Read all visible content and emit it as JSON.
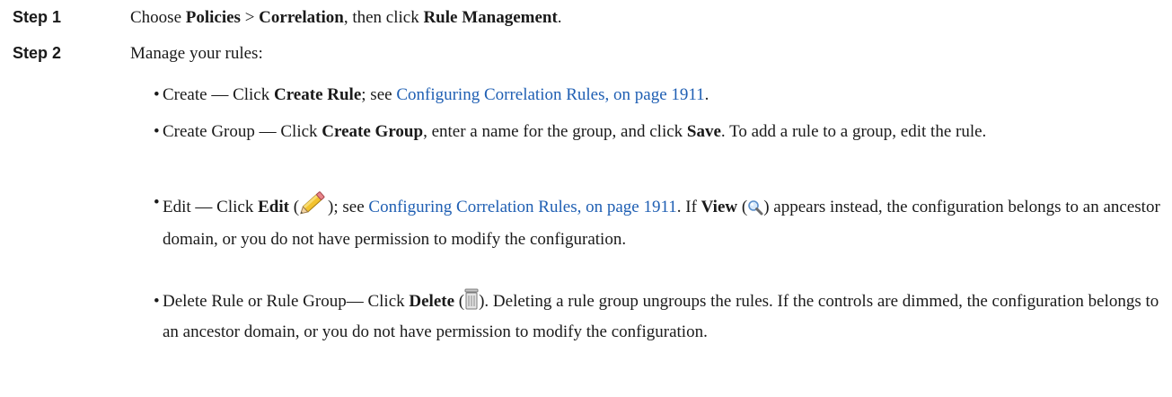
{
  "step1": {
    "label": "Step 1",
    "t1": "Choose ",
    "policies": "Policies",
    "t2": " > ",
    "correlation": "Correlation",
    "t3": ", then click ",
    "rule_mgmt": "Rule Management",
    "t4": "."
  },
  "step2": {
    "label": "Step 2",
    "text": "Manage your rules:"
  },
  "bullets": {
    "dot": "•",
    "create": {
      "t1": "Create — Click ",
      "b1": "Create Rule",
      "t2": "; see ",
      "link": "Configuring Correlation Rules, on page 1911",
      "t3": "."
    },
    "group": {
      "t1": "Create Group — Click ",
      "b1": "Create Group",
      "t2": ", enter a name for the group, and click ",
      "b2": "Save",
      "t3": ". To add a rule to a group, edit the rule."
    },
    "edit": {
      "t1": "Edit — Click ",
      "b1": "Edit",
      "t2": " (",
      "t3": "); see ",
      "link": "Configuring Correlation Rules, on page 1911",
      "t4": ". If ",
      "b2": "View",
      "t5": " (",
      "t6": ") appears instead, the configuration belongs to an ancestor domain, or you do not have permission to modify the configuration."
    },
    "delete": {
      "t1": "Delete Rule or Rule Group— Click ",
      "b1": "Delete",
      "t2": " (",
      "t3": "). Deleting a rule group ungroups the rules. If the controls are dimmed, the configuration belongs to an ancestor domain, or you do not have permission to modify the configuration."
    }
  },
  "icons": {
    "edit": "pencil-icon",
    "view": "magnifier-icon",
    "delete": "trash-can-icon"
  },
  "colors": {
    "link": "#1f5fb3",
    "text": "#1a1a1a"
  }
}
